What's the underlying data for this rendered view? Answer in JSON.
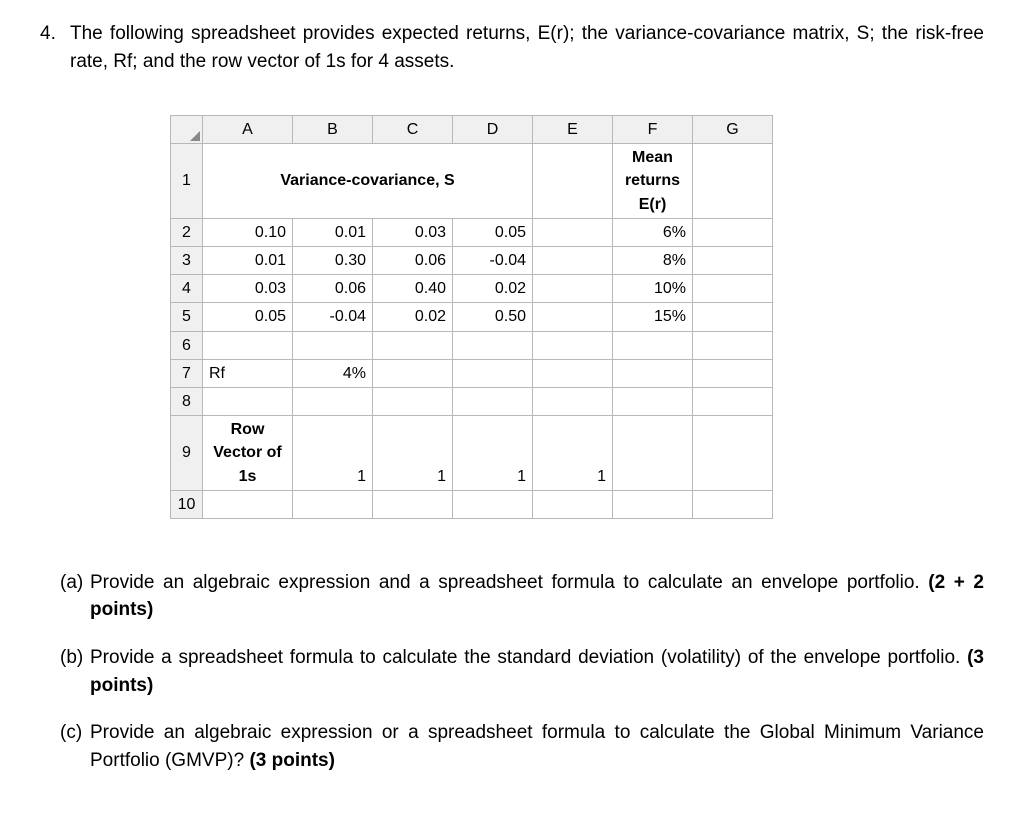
{
  "question": {
    "number": "4.",
    "text": "The following spreadsheet provides expected returns, E(r); the variance-covariance matrix, S; the risk-free rate, Rf; and the row vector of 1s for 4 assets."
  },
  "spreadsheet": {
    "columns": [
      "A",
      "B",
      "C",
      "D",
      "E",
      "F",
      "G"
    ],
    "header_variance": "Variance-covariance, S",
    "header_mean_line1": "Mean",
    "header_mean_line2": "returns",
    "header_mean_line3": "E(r)",
    "rows": {
      "r1": "1",
      "r2": "2",
      "r3": "3",
      "r4": "4",
      "r5": "5",
      "r6": "6",
      "r7": "7",
      "r8": "8",
      "r9": "9",
      "r10": "10"
    },
    "data": {
      "row2": {
        "a": "0.10",
        "b": "0.01",
        "c": "0.03",
        "d": "0.05",
        "f": "6%"
      },
      "row3": {
        "a": "0.01",
        "b": "0.30",
        "c": "0.06",
        "d": "-0.04",
        "f": "8%"
      },
      "row4": {
        "a": "0.03",
        "b": "0.06",
        "c": "0.40",
        "d": "0.02",
        "f": "10%"
      },
      "row5": {
        "a": "0.05",
        "b": "-0.04",
        "c": "0.02",
        "d": "0.50",
        "f": "15%"
      },
      "row7": {
        "a": "Rf",
        "b": "4%"
      },
      "row9": {
        "a_line1": "Row",
        "a_line2": "Vector of",
        "a_line3": "1s",
        "b": "1",
        "c": "1",
        "d": "1",
        "e": "1"
      }
    }
  },
  "sub_questions": {
    "a": {
      "label": "(a)",
      "text": "Provide an algebraic expression and a spreadsheet formula to calculate an envelope portfolio. ",
      "points": "(2 + 2 points)"
    },
    "b": {
      "label": "(b)",
      "text": "Provide a spreadsheet formula to calculate the standard deviation (volatility) of the envelope portfolio. ",
      "points": "(3 points)"
    },
    "c": {
      "label": "(c)",
      "text": "Provide an algebraic expression or a spreadsheet formula to calculate the Global Minimum Variance Portfolio (GMVP)? ",
      "points": "(3 points)"
    }
  },
  "chart_data": {
    "type": "table",
    "title": "Variance-covariance matrix and expected returns for 4 assets",
    "variance_covariance": [
      [
        0.1,
        0.01,
        0.03,
        0.05
      ],
      [
        0.01,
        0.3,
        0.06,
        -0.04
      ],
      [
        0.03,
        0.06,
        0.4,
        0.02
      ],
      [
        0.05,
        -0.04,
        0.02,
        0.5
      ]
    ],
    "mean_returns": [
      "6%",
      "8%",
      "10%",
      "15%"
    ],
    "risk_free_rate": "4%",
    "row_vector_of_1s": [
      1,
      1,
      1,
      1
    ]
  }
}
